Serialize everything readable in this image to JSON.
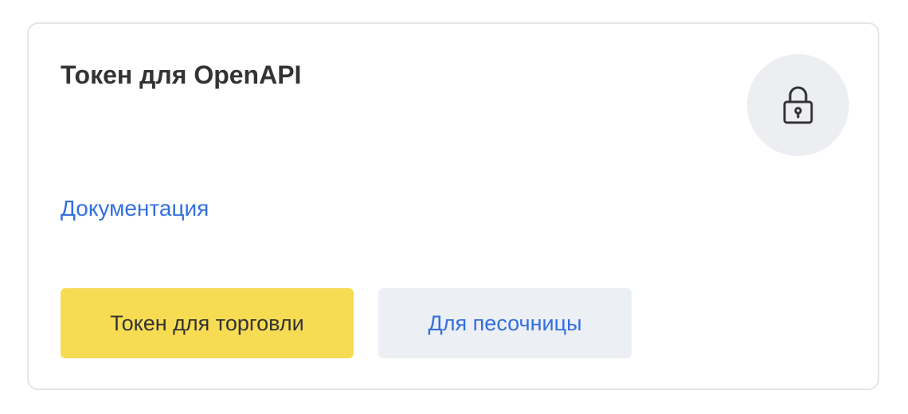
{
  "card": {
    "title": "Токен для OpenAPI",
    "icon": "lock-icon",
    "documentation_link": "Документация",
    "buttons": {
      "trade_label": "Токен для торговли",
      "sandbox_label": "Для песочницы"
    }
  },
  "colors": {
    "primary_button": "#f7dc53",
    "secondary_button": "#eceff4",
    "link": "#336fe0",
    "icon_circle": "#eceef2",
    "text": "#333333"
  }
}
